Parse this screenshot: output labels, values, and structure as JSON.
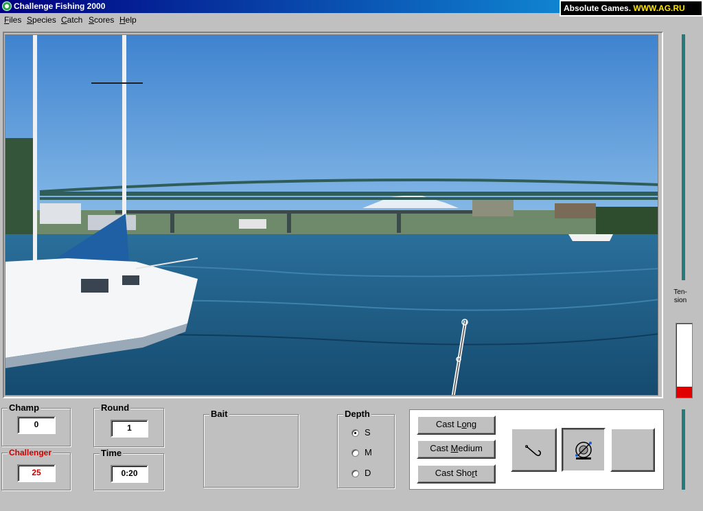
{
  "window": {
    "title": "Challenge Fishing 2000"
  },
  "brand": {
    "name": "Absolute Games.",
    "url": "WWW.AG.RU"
  },
  "menu": [
    {
      "label": "Files",
      "hotkey": "F"
    },
    {
      "label": "Species",
      "hotkey": "S"
    },
    {
      "label": "Catch",
      "hotkey": "C"
    },
    {
      "label": "Scores",
      "hotkey": "S"
    },
    {
      "label": "Help",
      "hotkey": "H"
    }
  ],
  "meters": {
    "tension_label_1": "Ten-",
    "tension_label_2": "sion",
    "tension_level": 0.15,
    "tension_color": "#e00000",
    "bar_color": "#267a7a"
  },
  "scores": {
    "champ_label": "Champ",
    "champ_value": "0",
    "challenger_label": "Challenger",
    "challenger_value": "25",
    "round_label": "Round",
    "round_value": "1",
    "time_label": "Time",
    "time_value": "0:20"
  },
  "bait": {
    "label": "Bait"
  },
  "depth": {
    "label": "Depth",
    "options": [
      {
        "label": "S",
        "checked": true
      },
      {
        "label": "M",
        "checked": false
      },
      {
        "label": "D",
        "checked": false
      }
    ]
  },
  "cast": {
    "long_pre": "Cast L",
    "long_key": "o",
    "long_post": "ng",
    "medium_pre": "Cast ",
    "medium_key": "M",
    "medium_post": "edium",
    "short_pre": "Cast Sho",
    "short_key": "r",
    "short_post": "t",
    "icons": [
      "hook-icon",
      "reel-icon",
      "empty-slot"
    ]
  }
}
